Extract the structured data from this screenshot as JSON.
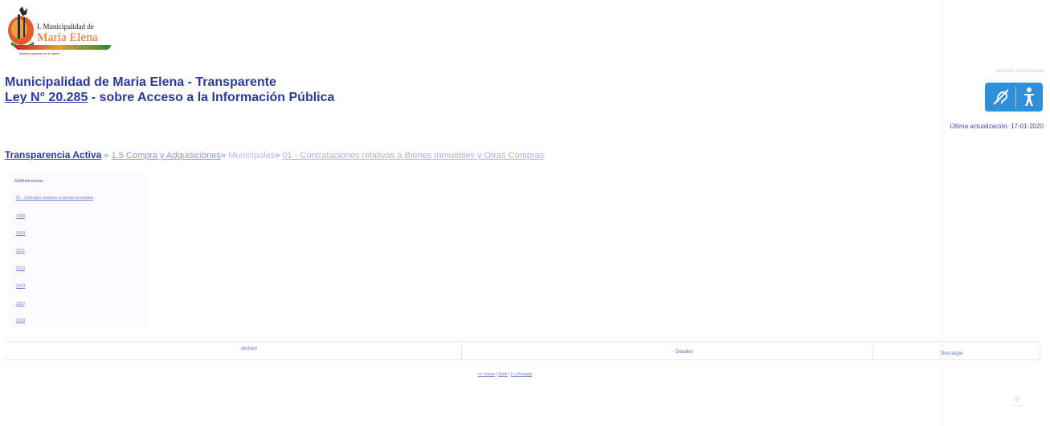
{
  "logo": {
    "line1": "I. Municipalidad de",
    "line2": "María Elena",
    "tagline": "Nuestro espacio es su parte"
  },
  "header": {
    "title": "Municipalidad de Maria Elena - Transparente",
    "law_link": "Ley N° 20.285",
    "law_rest": " - sobre Acceso a la Información Pública"
  },
  "accessibility": {
    "label": "Inclusión Accesibilidad",
    "icons": [
      "hearing-accessibility-icon",
      "person-accessibility-icon"
    ],
    "color": "#2f8fd8"
  },
  "last_update": "Última actualización: 17-01-2020",
  "breadcrumb": {
    "root": "Transparencia Activa",
    "sep": "»",
    "level1": "1.5 Compra y Adquisiciones",
    "level2": "Municipales",
    "level3": "01 - Contrataciones relativas a Bienes Inmuebles y Otras Compras"
  },
  "subpanel": {
    "title": "SubReferencias",
    "items": [
      "01 - Contratos relativos a bienes inmuebles",
      "2009",
      "2010",
      "2011",
      "2012",
      "2013",
      "2017",
      "2020"
    ]
  },
  "table": {
    "columns": [
      "Archivo",
      "Detalles",
      "Descargar"
    ]
  },
  "footer": {
    "back": "<< Volver",
    "sep1": " | ",
    "up": "Subir",
    "sep2": " | ",
    "home": "Ir a Portada"
  }
}
